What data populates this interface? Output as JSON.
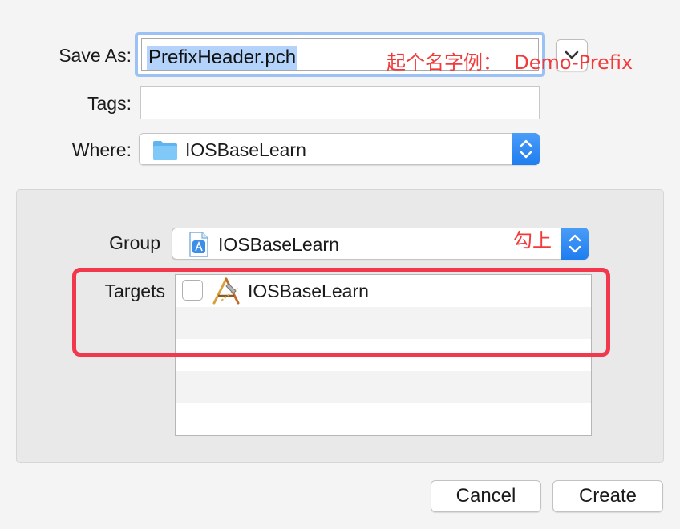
{
  "save_as": {
    "label": "Save As:",
    "value": "PrefixHeader.pch"
  },
  "tags": {
    "label": "Tags:",
    "value": ""
  },
  "where": {
    "label": "Where:",
    "selected": "IOSBaseLearn"
  },
  "group": {
    "label": "Group",
    "selected": "IOSBaseLearn"
  },
  "targets": {
    "label": "Targets",
    "items": [
      {
        "label": "IOSBaseLearn",
        "checked": false
      }
    ]
  },
  "annotations": {
    "name_hint": "起个名字例：  Demo-Prefix",
    "check_hint": "勾上"
  },
  "buttons": {
    "cancel": "Cancel",
    "create": "Create"
  },
  "colors": {
    "highlight": "#b3d3fb",
    "focus_ring": "#9cc2f5",
    "annotation": "#f23a3a",
    "stepper": "#2a84f2"
  }
}
